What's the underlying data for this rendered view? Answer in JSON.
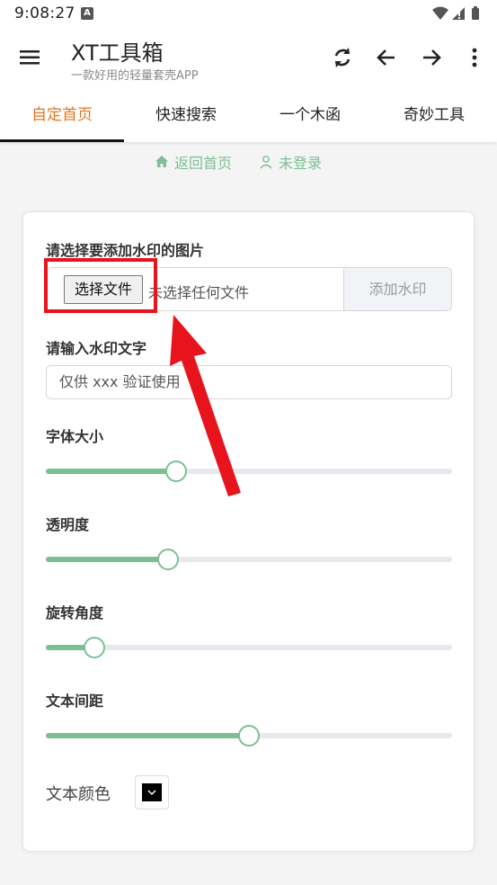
{
  "status": {
    "time": "9:08:27",
    "notification_letter": "A"
  },
  "app": {
    "title": "XT工具箱",
    "subtitle": "一款好用的轻量套壳APP"
  },
  "tabs": [
    {
      "label": "自定首页",
      "active": true
    },
    {
      "label": "快速搜索",
      "active": false
    },
    {
      "label": "一个木函",
      "active": false
    },
    {
      "label": "奇妙工具",
      "active": false
    }
  ],
  "links": {
    "home": "返回首页",
    "login": "未登录"
  },
  "form": {
    "image_label": "请选择要添加水印的图片",
    "choose_file_button": "选择文件",
    "no_file_text": "未选择任何文件",
    "add_watermark_button": "添加水印",
    "watermark_text_label": "请输入水印文字",
    "watermark_text_value": "仅供 xxx 验证使用",
    "font_size_label": "字体大小",
    "opacity_label": "透明度",
    "rotation_label": "旋转角度",
    "spacing_label": "文本间距",
    "color_label": "文本颜色"
  },
  "sliders": {
    "font_size": 0.32,
    "opacity": 0.3,
    "rotation": 0.12,
    "spacing": 0.5
  },
  "colors": {
    "accent": "#7cbf93",
    "active_tab": "#e27520",
    "highlight": "#e8141d",
    "text_color_value": "#000000"
  }
}
